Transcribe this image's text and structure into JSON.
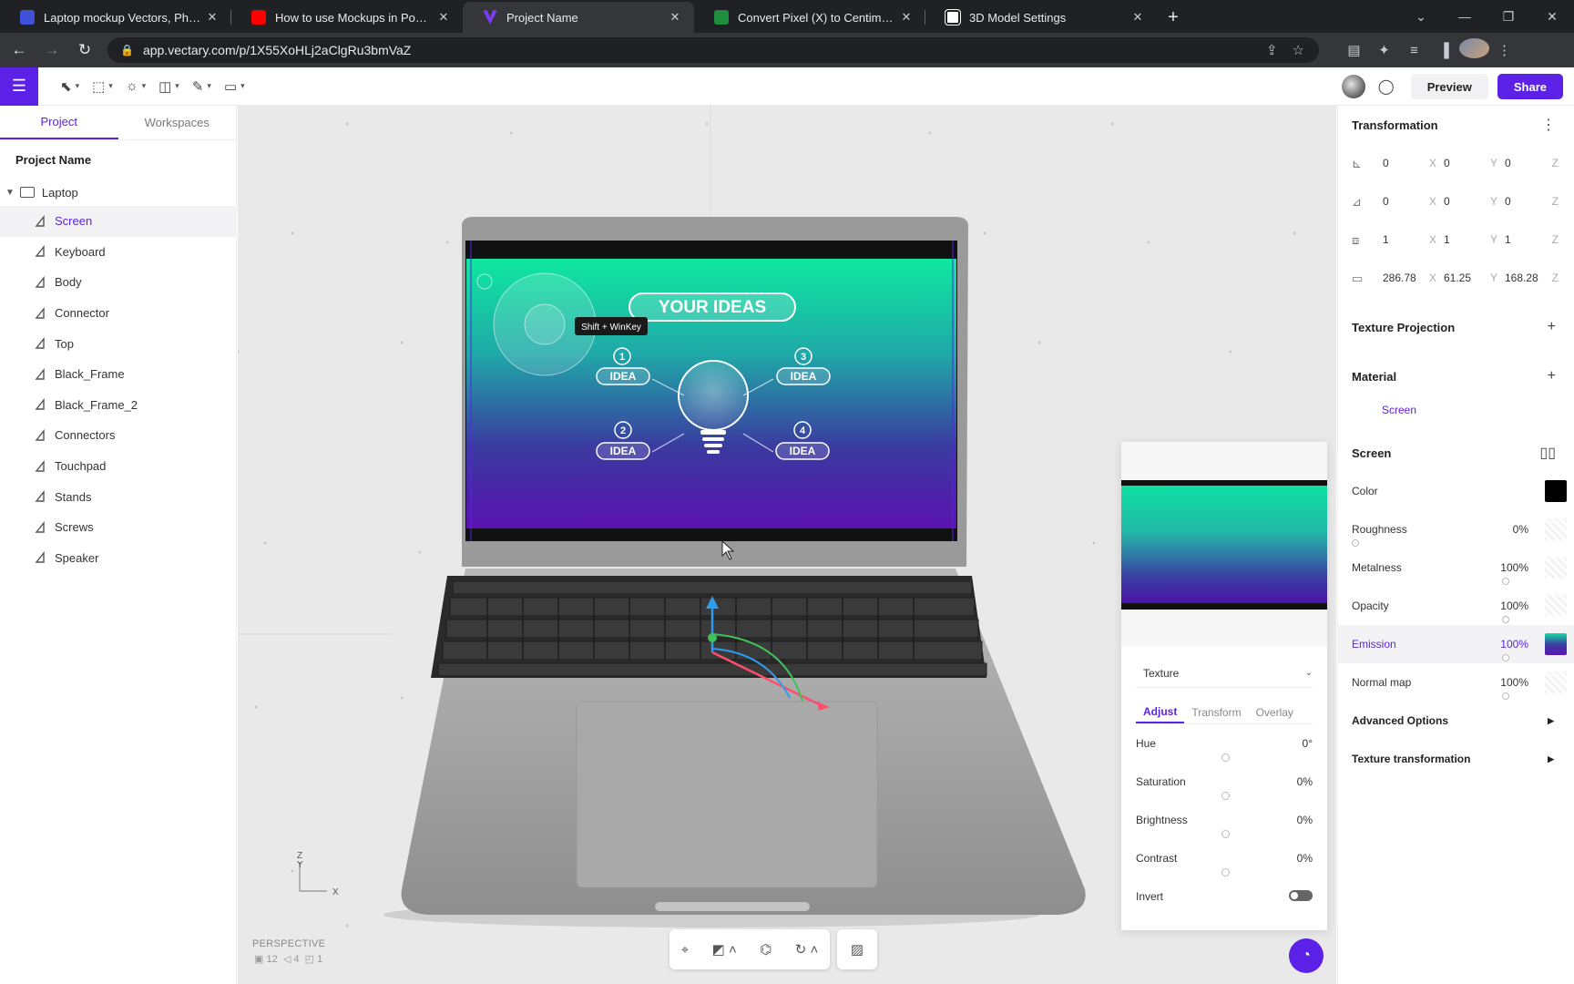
{
  "browser": {
    "tabs": [
      {
        "title": "Laptop mockup Vectors, Photos and PSD files",
        "favicon_color": "#3f51d8",
        "active": false
      },
      {
        "title": "How to use Mockups in PowerPoint",
        "favicon_color": "#ff0000",
        "active": false
      },
      {
        "title": "Project Name",
        "favicon_color": "#7a3cf0",
        "active": true
      },
      {
        "title": "Convert Pixel (X) to Centimeter",
        "favicon_color": "#1e8e3e",
        "active": false
      },
      {
        "title": "3D Model Settings",
        "favicon_color": "#ffffff",
        "active": false
      }
    ],
    "url": "app.vectary.com/p/1X55XoHLj2aClgRu3bmVaZ"
  },
  "app": {
    "preview_label": "Preview",
    "share_label": "Share",
    "accent": "#5b21e6"
  },
  "left_panel": {
    "tabs": [
      "Project",
      "Workspaces"
    ],
    "project_name": "Project Name",
    "root": "Laptop",
    "items": [
      "Screen",
      "Keyboard",
      "Body",
      "Connector",
      "Top",
      "Black_Frame",
      "Black_Frame_2",
      "Connectors",
      "Touchpad",
      "Stands",
      "Screws",
      "Speaker"
    ],
    "selected": "Screen"
  },
  "viewport": {
    "camera_label": "PERSPECTIVE",
    "stats": [
      "12",
      "4",
      "1"
    ],
    "tooltip": "Shift + WinKey",
    "screen_title": "YOUR IDEAS",
    "idea_label": "IDEA",
    "idea_numbers": [
      "1",
      "2",
      "3",
      "4"
    ],
    "axis_z": "Z",
    "axis_y": "Y",
    "axis_x": "X"
  },
  "texture_panel": {
    "dropdown_value": "Texture",
    "tabs": [
      "Adjust",
      "Transform",
      "Overlay"
    ],
    "rows": [
      {
        "label": "Hue",
        "value": "0°"
      },
      {
        "label": "Saturation",
        "value": "0%"
      },
      {
        "label": "Brightness",
        "value": "0%"
      },
      {
        "label": "Contrast",
        "value": "0%"
      }
    ],
    "invert_label": "Invert",
    "invert_on": false
  },
  "right_panel": {
    "transformation_title": "Transformation",
    "position": [
      "0",
      "0",
      "0"
    ],
    "rotation": [
      "0",
      "0",
      "0"
    ],
    "scale": [
      "1",
      "1",
      "1"
    ],
    "size": [
      "286.78",
      "61.25",
      "168.28"
    ],
    "axes": [
      "X",
      "Y",
      "Z"
    ],
    "texture_projection_title": "Texture Projection",
    "material_title": "Material",
    "material_name": "Screen",
    "screen_title": "Screen",
    "props": [
      {
        "label": "Color",
        "value": "",
        "fraction": null
      },
      {
        "label": "Roughness",
        "value": "0%",
        "fraction": 0
      },
      {
        "label": "Metalness",
        "value": "100%",
        "fraction": 1
      },
      {
        "label": "Opacity",
        "value": "100%",
        "fraction": 1
      },
      {
        "label": "Emission",
        "value": "100%",
        "fraction": 1
      },
      {
        "label": "Normal map",
        "value": "100%",
        "fraction": 1
      }
    ],
    "advanced_options": "Advanced Options",
    "texture_transformation": "Texture transformation"
  }
}
